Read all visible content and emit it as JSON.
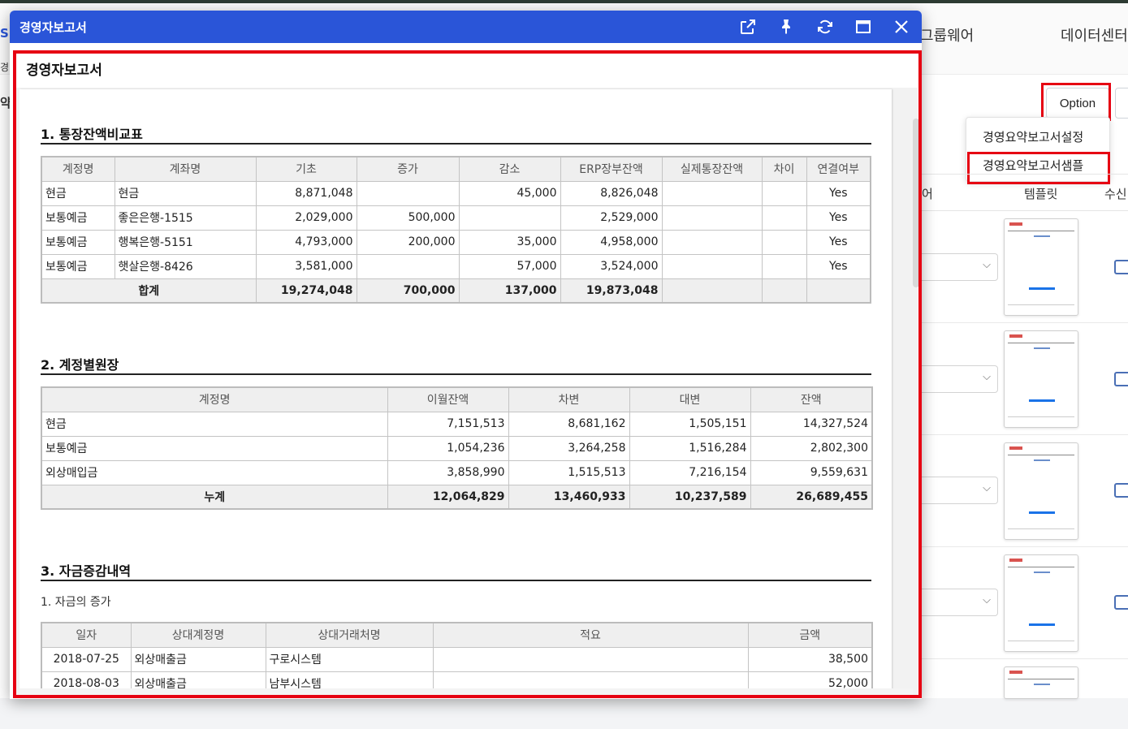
{
  "background": {
    "nav": {
      "item_group": "그룹웨어",
      "item_data": "데이터센터"
    },
    "left_chars": [
      "S",
      "경",
      "약"
    ],
    "option_button": "Option",
    "dropdown": {
      "items": [
        "경영요약보고서설정",
        "경영요약보고서샘플"
      ]
    },
    "table_headers": {
      "col1": "어",
      "col2": "템플릿",
      "col3": "수신"
    },
    "select_arrow": "⌵"
  },
  "modal": {
    "title": "경영자보고서",
    "header_icons": [
      "external-link-icon",
      "pin-icon",
      "refresh-icon",
      "maximize-icon",
      "close-icon"
    ],
    "report_title": "경영자보고서"
  },
  "section1": {
    "title": "1. 통장잔액비교표",
    "headers": [
      "계정명",
      "계좌명",
      "기초",
      "증가",
      "감소",
      "ERP장부잔액",
      "실제통장잔액",
      "차이",
      "연결여부"
    ],
    "rows": [
      [
        "현금",
        "현금",
        "8,871,048",
        "",
        "45,000",
        "8,826,048",
        "",
        "",
        "Yes"
      ],
      [
        "보통예금",
        "좋은은행-1515",
        "2,029,000",
        "500,000",
        "",
        "2,529,000",
        "",
        "",
        "Yes"
      ],
      [
        "보통예금",
        "행복은행-5151",
        "4,793,000",
        "200,000",
        "35,000",
        "4,958,000",
        "",
        "",
        "Yes"
      ],
      [
        "보통예금",
        "햇살은행-8426",
        "3,581,000",
        "",
        "57,000",
        "3,524,000",
        "",
        "",
        "Yes"
      ]
    ],
    "total": [
      "합계",
      "19,274,048",
      "700,000",
      "137,000",
      "19,873,048",
      "",
      "",
      ""
    ]
  },
  "section2": {
    "title": "2. 계정별원장",
    "headers": [
      "계정명",
      "이월잔액",
      "차변",
      "대변",
      "잔액"
    ],
    "rows": [
      [
        "현금",
        "7,151,513",
        "8,681,162",
        "1,505,151",
        "14,327,524"
      ],
      [
        "보통예금",
        "1,054,236",
        "3,264,258",
        "1,516,284",
        "2,802,300"
      ],
      [
        "외상매입금",
        "3,858,990",
        "1,515,513",
        "7,216,154",
        "9,559,631"
      ]
    ],
    "total": [
      "누계",
      "12,064,829",
      "13,460,933",
      "10,237,589",
      "26,689,455"
    ]
  },
  "section3": {
    "title": "3. 자금증감내역",
    "subtitle": "1. 자금의 증가",
    "headers": [
      "일자",
      "상대계정명",
      "상대거래처명",
      "적요",
      "금액"
    ],
    "rows": [
      [
        "2018-07-25",
        "외상매출금",
        "구로시스템",
        "",
        "38,500"
      ],
      [
        "2018-08-03",
        "외상매출금",
        "남부시스템",
        "",
        "52,000"
      ]
    ]
  }
}
